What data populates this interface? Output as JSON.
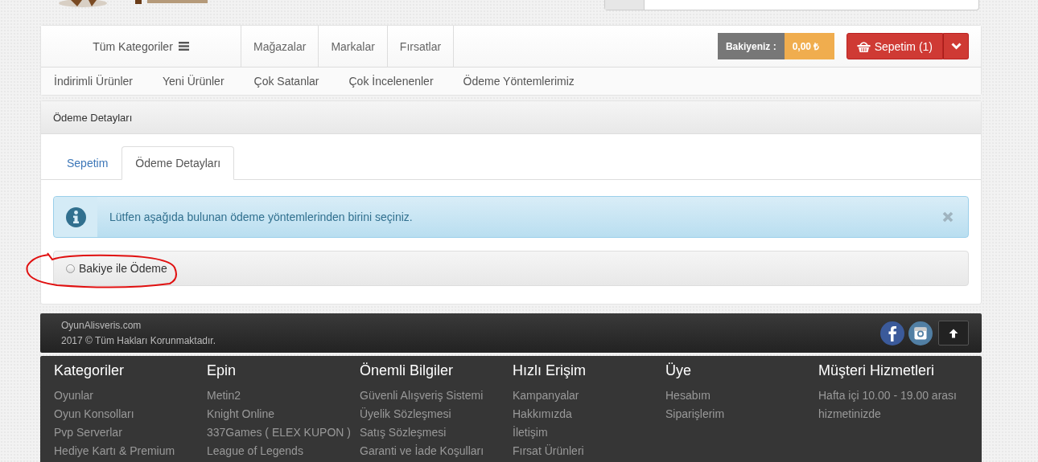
{
  "nav": {
    "categories_button": "Tüm Kategoriler",
    "links": [
      "Mağazalar",
      "Markalar",
      "Fırsatlar"
    ],
    "balance": {
      "label": "Bakiyeniz :",
      "value": "0,00 ₺"
    },
    "cart": {
      "label": "Sepetim (1)"
    },
    "sub_links": [
      "İndirimli Ürünler",
      "Yeni Ürünler",
      "Çok Satanlar",
      "Çok İncelenenler",
      "Ödeme Yöntemlerimiz"
    ]
  },
  "panel": {
    "title": "Ödeme Detayları",
    "tabs": [
      {
        "label": "Sepetim",
        "selected": false
      },
      {
        "label": "Ödeme Detayları",
        "selected": true
      }
    ],
    "alert": {
      "text": "Lütfen aşağıda bulunan ödeme yöntemlerinden birini seçiniz."
    },
    "payment_options": [
      {
        "label": "Bakiye ile Ödeme",
        "selected": false
      }
    ]
  },
  "footer": {
    "site": "OyunAlisveris.com",
    "copyright": "2017 © Tüm Hakları Korunmaktadır.",
    "columns": [
      {
        "kind": "links",
        "title": "Kategoriler",
        "items": [
          "Oyunlar",
          "Oyun Konsolları",
          "Pvp Serverlar",
          "Hediye Kartı & Premium"
        ]
      },
      {
        "kind": "links",
        "title": "Epin",
        "items": [
          "Metin2",
          "Knight Online",
          "337Games ( ELEX KUPON )",
          "League of Legends"
        ]
      },
      {
        "kind": "links",
        "title": "Önemli Bilgiler",
        "items": [
          "Güvenli Alışveriş Sistemi",
          "Üyelik Sözleşmesi",
          "Satış Sözleşmesi",
          "Garanti ve İade Koşulları"
        ]
      },
      {
        "kind": "links",
        "title": "Hızlı Erişim",
        "items": [
          "Kampanyalar",
          "Hakkımızda",
          "İletişim",
          "Fırsat Ürünleri"
        ]
      },
      {
        "kind": "links",
        "title": "Üye",
        "items": [
          "Hesabım",
          "Siparişlerim"
        ]
      },
      {
        "kind": "text",
        "title": "Müşteri Hizmetleri",
        "text": "Hafta içi 10.00 - 19.00 arası hizmetinizde"
      }
    ]
  }
}
